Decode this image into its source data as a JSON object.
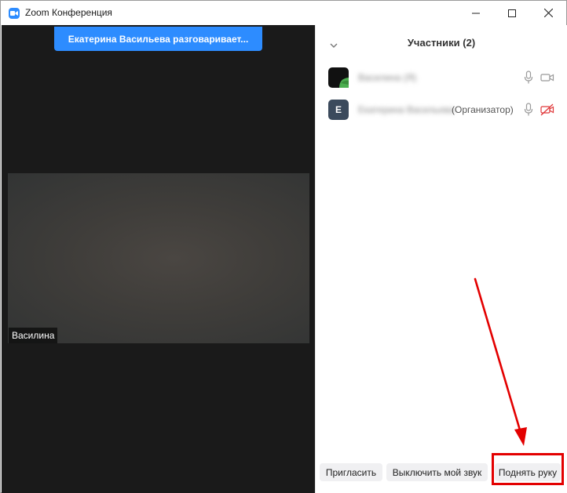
{
  "window": {
    "title": "Zoom Конференция",
    "app_icon": "zoom-camera-icon",
    "controls": [
      "minimize-icon",
      "maximize-icon",
      "close-icon"
    ]
  },
  "video": {
    "speaking_banner": "Екатерина Васильева разговаривает...",
    "tile_name": "Василина"
  },
  "participants_panel": {
    "title": "Участники (2)",
    "items": [
      {
        "name": "Василина (Я)",
        "avatar_color": "#111111",
        "mic_icon": "microphone-icon",
        "video_icon": "video-camera-icon"
      },
      {
        "name": "Екатерина Васильева",
        "avatar_initial": "E",
        "avatar_color": "#3b4a5c",
        "role": "(Организатор)",
        "mic_icon": "microphone-icon",
        "video_icon": "video-off-icon"
      }
    ],
    "buttons": {
      "invite": "Пригласить",
      "mute_me": "Выключить мой звук",
      "raise_hand": "Поднять руку"
    }
  },
  "annotation": {
    "color": "#e30000"
  }
}
